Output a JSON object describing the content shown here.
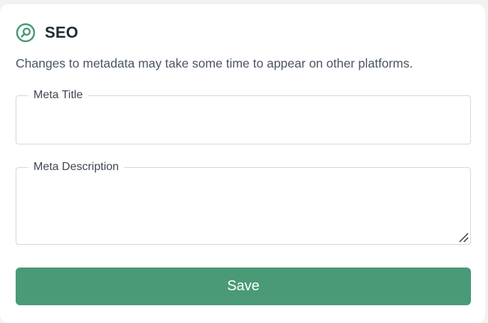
{
  "card": {
    "title": "SEO",
    "title_icon": "search-magnifier-circle-icon",
    "description": "Changes to metadata may take some time to appear on other platforms."
  },
  "fields": {
    "meta_title": {
      "label": "Meta Title",
      "value": ""
    },
    "meta_description": {
      "label": "Meta Description",
      "value": ""
    }
  },
  "actions": {
    "save_label": "Save"
  },
  "colors": {
    "accent": "#4a9a78",
    "background": "#f2f2f1",
    "card": "#ffffff",
    "border": "#d6d6d6",
    "heading": "#1f2937",
    "body_text": "#4b5563"
  }
}
